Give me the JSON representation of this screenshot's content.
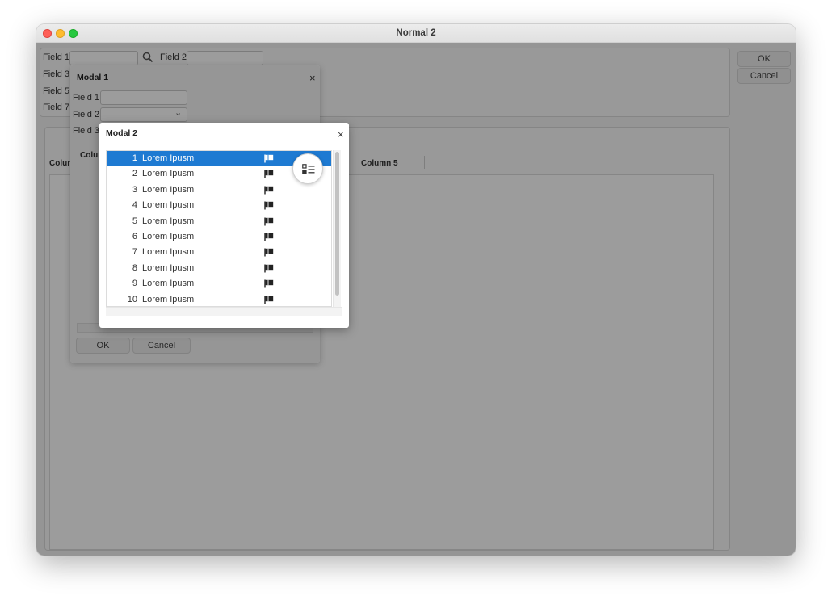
{
  "window": {
    "title": "Normal 2"
  },
  "main_form": {
    "labels": [
      "Field 1",
      "Field 2",
      "Field 3",
      "Field 5",
      "Field 7"
    ],
    "search_icon": "search-icon",
    "ok_label": "OK",
    "cancel_label": "Cancel",
    "columns": [
      "Colun",
      "Column 5"
    ]
  },
  "modal1": {
    "title": "Modal 1",
    "close": "×",
    "labels": [
      "Field 1",
      "Field 2",
      "Field 3"
    ],
    "chevron": "⌄",
    "column_header": "Colum",
    "ok_label": "OK",
    "cancel_label": "Cancel"
  },
  "modal2": {
    "title": "Modal 2",
    "close": "×",
    "selected_index": 0,
    "rows": [
      {
        "num": "1",
        "text": "Lorem Ipusm"
      },
      {
        "num": "2",
        "text": "Lorem Ipusm"
      },
      {
        "num": "3",
        "text": "Lorem Ipusm"
      },
      {
        "num": "4",
        "text": "Lorem Ipusm"
      },
      {
        "num": "5",
        "text": "Lorem Ipusm"
      },
      {
        "num": "6",
        "text": "Lorem Ipusm"
      },
      {
        "num": "7",
        "text": "Lorem Ipusm"
      },
      {
        "num": "8",
        "text": "Lorem Ipusm"
      },
      {
        "num": "9",
        "text": "Lorem Ipusm"
      },
      {
        "num": "10",
        "text": "Lorem Ipusm"
      }
    ],
    "row_icon": "flag-icon",
    "fab_icon": "checklist-icon"
  },
  "colors": {
    "selection": "#1e7ad2",
    "overlay": "rgba(0,0,0,0.39)"
  }
}
